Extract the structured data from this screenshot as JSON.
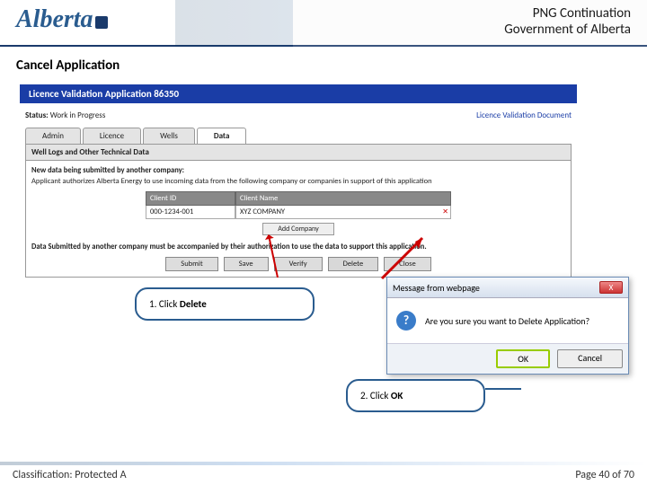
{
  "header": {
    "logo_text": "Alberta",
    "title_line1": "PNG Continuation",
    "title_line2": "Government of Alberta"
  },
  "section_title": "Cancel Application",
  "app": {
    "banner": "Licence Validation Application 86350",
    "status_label": "Status:",
    "status_value": "Work in Progress",
    "doc_link": "Licence Validation Document",
    "tabs": [
      "Admin",
      "Licence",
      "Wells",
      "Data"
    ],
    "active_tab": "Data",
    "tab_subhead": "Well Logs and Other Technical Data",
    "desc_bold": "New data being submitted by another company:",
    "desc_rest": "Applicant authorizes Alberta Energy to use incoming data from the following company or companies in support of this application",
    "table": {
      "head": [
        "Client ID",
        "Client Name"
      ],
      "row": [
        "000-1234-001",
        "XYZ COMPANY"
      ]
    },
    "add_company": "Add Company",
    "auth_line": "Data Submitted by another company must be accompanied by their authorization to use the data to support this application.",
    "actions": [
      "Submit",
      "Save",
      "Verify",
      "Delete",
      "Close"
    ]
  },
  "callouts": {
    "c1_prefix": "1. Click ",
    "c1_bold": "Delete",
    "c2_prefix": "2. Click ",
    "c2_bold": "OK"
  },
  "dialog": {
    "title": "Message from webpage",
    "close_glyph": "X",
    "icon_glyph": "?",
    "body": "Are you sure you want to Delete Application?",
    "ok": "OK",
    "cancel": "Cancel"
  },
  "footer": {
    "classification": "Classification: Protected A",
    "page": "Page 40 of 70"
  }
}
